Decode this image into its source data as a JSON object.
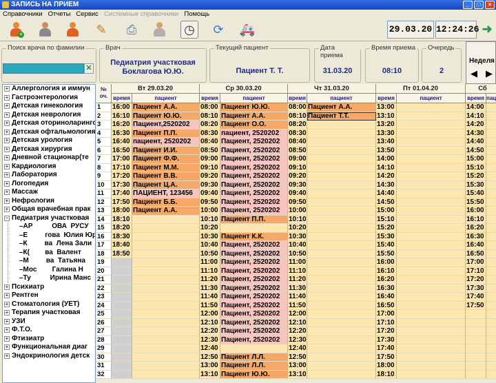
{
  "window": {
    "title": "ЗАПИСЬ НА ПРИЕМ"
  },
  "menu": [
    {
      "label": "Справочники",
      "disabled": false
    },
    {
      "label": "Отчеты",
      "disabled": false
    },
    {
      "label": "Сервис",
      "disabled": false
    },
    {
      "label": "Системные справочники",
      "disabled": true
    },
    {
      "label": "Помощь",
      "disabled": false
    }
  ],
  "toolbar": {
    "date": "29.03.20",
    "time": "12:24:26"
  },
  "panels": {
    "search": {
      "legend": "Поиск врача по фамилии",
      "value": ""
    },
    "doctor": {
      "legend": "Врач",
      "line1": "Педиатрия участковая",
      "line2": "Боклагова Ю.Ю."
    },
    "patient": {
      "legend": "Текущий пациент",
      "value": "Пациент Т. Т."
    },
    "visit_date": {
      "legend": "Дата приема",
      "value": "31.03.20"
    },
    "visit_time": {
      "legend": "Время приема",
      "value": "08:10"
    },
    "queue": {
      "legend": "Очередь",
      "value": "2"
    },
    "week": {
      "label": "Неделя"
    }
  },
  "tree": [
    {
      "label": "Аллергология и иммун",
      "expanded": false
    },
    {
      "label": "Гастроэнтерология",
      "expanded": false
    },
    {
      "label": "Детская гинекология",
      "expanded": false
    },
    {
      "label": "Детская неврология",
      "expanded": false
    },
    {
      "label": "Детская оториноларинголо",
      "expanded": false
    },
    {
      "label": "Детская офтальмология",
      "expanded": false
    },
    {
      "label": "Детская урология",
      "expanded": false
    },
    {
      "label": "Детская хирургия",
      "expanded": false
    },
    {
      "label": "Дневной стационар(те",
      "expanded": false
    },
    {
      "label": "Кардиология",
      "expanded": false
    },
    {
      "label": "Лаборатория",
      "expanded": false
    },
    {
      "label": "Логопедия",
      "expanded": false
    },
    {
      "label": "Массаж",
      "expanded": false
    },
    {
      "label": "Нефрология",
      "expanded": false
    },
    {
      "label": "Общая врачебная прак",
      "expanded": false
    },
    {
      "label": "Педиатрия участковая",
      "expanded": true,
      "children": [
        "АР          ОВА  РУСУ",
        "Е         гова  Юлия Юр",
        "К         ва  Лена Зали",
        "К(        ва  Валент",
        "М         ва  Татьяна",
        "Мос        Галина Н",
        "Ту          Ирина Манс"
      ]
    },
    {
      "label": "Психиатр",
      "expanded": false
    },
    {
      "label": "Рентген",
      "expanded": false
    },
    {
      "label": "Стоматология (УЕТ)",
      "expanded": false
    },
    {
      "label": "Терапия участковая",
      "expanded": false
    },
    {
      "label": "УЗИ",
      "expanded": false
    },
    {
      "label": "Ф.Т.О.",
      "expanded": false
    },
    {
      "label": "Фтизиатр",
      "expanded": false
    },
    {
      "label": "Функциональная диаг",
      "expanded": false
    },
    {
      "label": "Эндокринология детск",
      "expanded": false
    }
  ],
  "schedule": {
    "no_header": "№ оч.",
    "time_label": "время",
    "patient_label": "пациент",
    "days": [
      "Вт 29.03.20",
      "Ср 30.03.20",
      "Чт 31.03.20",
      "Пт 01.04.20",
      "Сб"
    ],
    "rows": [
      {
        "n": "1",
        "d": [
          [
            "16:00",
            "Пациент А.А.",
            "f"
          ],
          [
            "08:00",
            "Пациент Ю.Ю.",
            "f"
          ],
          [
            "08:00",
            "Пациент А.А.",
            "f"
          ],
          [
            "13:00",
            "",
            ""
          ],
          [
            "14:00",
            "",
            ""
          ]
        ]
      },
      {
        "n": "2",
        "d": [
          [
            "16:10",
            "Пациент Ю.Ю.",
            "f"
          ],
          [
            "08:10",
            "Пациент А.А.",
            "f"
          ],
          [
            "08:10",
            "Пациент Т.Т.",
            "f"
          ],
          [
            "13:10",
            "",
            ""
          ],
          [
            "14:10",
            "",
            ""
          ]
        ]
      },
      {
        "n": "3",
        "d": [
          [
            "16:20",
            "Пациент,2520202",
            "p"
          ],
          [
            "08:20",
            "Пациент О.О.",
            "f"
          ],
          [
            "08:20",
            "",
            ""
          ],
          [
            "13:20",
            "",
            ""
          ],
          [
            "14:20",
            "",
            ""
          ]
        ]
      },
      {
        "n": "4",
        "d": [
          [
            "16:30",
            "Пациент П.П.",
            "f"
          ],
          [
            "08:30",
            "пациент, 2520202",
            "p"
          ],
          [
            "08:30",
            "",
            ""
          ],
          [
            "13:30",
            "",
            ""
          ],
          [
            "14:30",
            "",
            ""
          ]
        ]
      },
      {
        "n": "5",
        "d": [
          [
            "16:40",
            "пациент, 2520202",
            "p"
          ],
          [
            "08:40",
            "Пациент, 2520202",
            "p"
          ],
          [
            "08:40",
            "",
            ""
          ],
          [
            "13:40",
            "",
            ""
          ],
          [
            "14:40",
            "",
            ""
          ]
        ]
      },
      {
        "n": "6",
        "d": [
          [
            "16:50",
            "Пациент И.И.",
            "f"
          ],
          [
            "08:50",
            "Пациент, 2520202",
            "p"
          ],
          [
            "08:50",
            "",
            ""
          ],
          [
            "13:50",
            "",
            ""
          ],
          [
            "14:50",
            "",
            ""
          ]
        ]
      },
      {
        "n": "7",
        "d": [
          [
            "17:00",
            "Пациент Ф.Ф.",
            "f"
          ],
          [
            "09:00",
            "Пациент, 2520202",
            "p"
          ],
          [
            "09:00",
            "",
            ""
          ],
          [
            "14:00",
            "",
            ""
          ],
          [
            "15:00",
            "",
            ""
          ]
        ]
      },
      {
        "n": "8",
        "d": [
          [
            "17:10",
            "Пациент М.М.",
            "f"
          ],
          [
            "09:10",
            "Пациент, 2520202",
            "p"
          ],
          [
            "09:10",
            "",
            ""
          ],
          [
            "14:10",
            "",
            ""
          ],
          [
            "15:10",
            "",
            ""
          ]
        ]
      },
      {
        "n": "9",
        "d": [
          [
            "17:20",
            "Пациент В.В.",
            "f"
          ],
          [
            "09:20",
            "Пациент, 2520202",
            "p"
          ],
          [
            "09:20",
            "",
            ""
          ],
          [
            "14:20",
            "",
            ""
          ],
          [
            "15:20",
            "",
            ""
          ]
        ]
      },
      {
        "n": "10",
        "d": [
          [
            "17:30",
            "Пациент Ц.А.",
            "f"
          ],
          [
            "09:30",
            "Пациент, 2520202",
            "p"
          ],
          [
            "09:30",
            "",
            ""
          ],
          [
            "14:30",
            "",
            ""
          ],
          [
            "15:30",
            "",
            ""
          ]
        ]
      },
      {
        "n": "11",
        "d": [
          [
            "17:40",
            "ПАЦИЕНТ, 123456",
            "p"
          ],
          [
            "09:40",
            "Пациент, 2520202",
            "p"
          ],
          [
            "09:40",
            "",
            ""
          ],
          [
            "14:40",
            "",
            ""
          ],
          [
            "15:40",
            "",
            ""
          ]
        ]
      },
      {
        "n": "12",
        "d": [
          [
            "17:50",
            "Пациент Б.Б.",
            "f"
          ],
          [
            "09:50",
            "Пациент, 2520202",
            "p"
          ],
          [
            "09:50",
            "",
            ""
          ],
          [
            "14:50",
            "",
            ""
          ],
          [
            "15:50",
            "",
            ""
          ]
        ]
      },
      {
        "n": "13",
        "d": [
          [
            "18:00",
            "Пациент А.А.",
            "f"
          ],
          [
            "10:00",
            "Пациент, 2520202",
            "p"
          ],
          [
            "10:00",
            "",
            ""
          ],
          [
            "15:00",
            "",
            ""
          ],
          [
            "16:00",
            "",
            ""
          ]
        ]
      },
      {
        "n": "14",
        "d": [
          [
            "18:10",
            "",
            ""
          ],
          [
            "10:10",
            "Пациент П.П.",
            "f"
          ],
          [
            "10:10",
            "",
            ""
          ],
          [
            "15:10",
            "",
            ""
          ],
          [
            "16:10",
            "",
            ""
          ]
        ]
      },
      {
        "n": "15",
        "d": [
          [
            "18:20",
            "",
            ""
          ],
          [
            "10:20",
            "",
            ""
          ],
          [
            "10:20",
            "",
            ""
          ],
          [
            "15:20",
            "",
            ""
          ],
          [
            "16:20",
            "",
            ""
          ]
        ]
      },
      {
        "n": "16",
        "d": [
          [
            "18:30",
            "",
            ""
          ],
          [
            "10:30",
            "Пациент К.К.",
            "f"
          ],
          [
            "10:30",
            "",
            ""
          ],
          [
            "15:30",
            "",
            ""
          ],
          [
            "16:30",
            "",
            ""
          ]
        ]
      },
      {
        "n": "17",
        "d": [
          [
            "18:40",
            "",
            ""
          ],
          [
            "10:40",
            "Пациент, 2520202",
            "p"
          ],
          [
            "10:40",
            "",
            ""
          ],
          [
            "15:40",
            "",
            ""
          ],
          [
            "16:40",
            "",
            ""
          ]
        ]
      },
      {
        "n": "18",
        "d": [
          [
            "18:50",
            "",
            ""
          ],
          [
            "10:50",
            "Пациент, 2520202",
            "p"
          ],
          [
            "10:50",
            "",
            ""
          ],
          [
            "15:50",
            "",
            ""
          ],
          [
            "16:50",
            "",
            ""
          ]
        ]
      },
      {
        "n": "19",
        "d": [
          [
            "",
            "",
            "e"
          ],
          [
            "11:00",
            "Пациент, 2520202",
            "p"
          ],
          [
            "11:00",
            "",
            ""
          ],
          [
            "16:00",
            "",
            ""
          ],
          [
            "17:00",
            "",
            ""
          ]
        ]
      },
      {
        "n": "20",
        "d": [
          [
            "",
            "",
            "e"
          ],
          [
            "11:10",
            "Пациент, 2520202",
            "p"
          ],
          [
            "11:10",
            "",
            ""
          ],
          [
            "16:10",
            "",
            ""
          ],
          [
            "17:10",
            "",
            ""
          ]
        ]
      },
      {
        "n": "21",
        "d": [
          [
            "",
            "",
            "e"
          ],
          [
            "11:20",
            "Пациент, 2520202",
            "p"
          ],
          [
            "11:20",
            "",
            ""
          ],
          [
            "16:20",
            "",
            ""
          ],
          [
            "17:20",
            "",
            ""
          ]
        ]
      },
      {
        "n": "22",
        "d": [
          [
            "",
            "",
            "e"
          ],
          [
            "11:30",
            "Пациент, 2520202",
            "p"
          ],
          [
            "11:30",
            "",
            ""
          ],
          [
            "16:30",
            "",
            ""
          ],
          [
            "17:30",
            "",
            ""
          ]
        ]
      },
      {
        "n": "23",
        "d": [
          [
            "",
            "",
            "e"
          ],
          [
            "11:40",
            "Пациент, 2520202",
            "p"
          ],
          [
            "11:40",
            "",
            ""
          ],
          [
            "16:40",
            "",
            ""
          ],
          [
            "17:40",
            "",
            ""
          ]
        ]
      },
      {
        "n": "24",
        "d": [
          [
            "",
            "",
            "e"
          ],
          [
            "11:50",
            "Пациент, 2520202",
            "p"
          ],
          [
            "11:50",
            "",
            ""
          ],
          [
            "16:50",
            "",
            ""
          ],
          [
            "17:50",
            "",
            ""
          ]
        ]
      },
      {
        "n": "25",
        "d": [
          [
            "",
            "",
            "e"
          ],
          [
            "12:00",
            "Пациент, 2520202",
            "p"
          ],
          [
            "12:00",
            "",
            ""
          ],
          [
            "17:00",
            "",
            ""
          ],
          [
            "",
            "",
            ""
          ]
        ]
      },
      {
        "n": "26",
        "d": [
          [
            "",
            "",
            "e"
          ],
          [
            "12:10",
            "Пациент, 2520202",
            "p"
          ],
          [
            "12:10",
            "",
            ""
          ],
          [
            "17:10",
            "",
            ""
          ],
          [
            "",
            "",
            ""
          ]
        ]
      },
      {
        "n": "27",
        "d": [
          [
            "",
            "",
            "e"
          ],
          [
            "12:20",
            "Пациент, 2520202",
            "p"
          ],
          [
            "12:20",
            "",
            ""
          ],
          [
            "17:20",
            "",
            ""
          ],
          [
            "",
            "",
            ""
          ]
        ]
      },
      {
        "n": "28",
        "d": [
          [
            "",
            "",
            "e"
          ],
          [
            "12:30",
            "Пациент, 2520202",
            "p"
          ],
          [
            "12:30",
            "",
            ""
          ],
          [
            "17:30",
            "",
            ""
          ],
          [
            "",
            "",
            ""
          ]
        ]
      },
      {
        "n": "29",
        "d": [
          [
            "",
            "",
            "e"
          ],
          [
            "12:40",
            "",
            ""
          ],
          [
            "12:40",
            "",
            ""
          ],
          [
            "17:40",
            "",
            ""
          ],
          [
            "",
            "",
            ""
          ]
        ]
      },
      {
        "n": "30",
        "d": [
          [
            "",
            "",
            "e"
          ],
          [
            "12:50",
            "Пациент Л.Л.",
            "f"
          ],
          [
            "12:50",
            "",
            ""
          ],
          [
            "17:50",
            "",
            ""
          ],
          [
            "",
            "",
            ""
          ]
        ]
      },
      {
        "n": "31",
        "d": [
          [
            "",
            "",
            "e"
          ],
          [
            "13:00",
            "Пациент Л.Л.",
            "f"
          ],
          [
            "13:00",
            "",
            ""
          ],
          [
            "18:00",
            "",
            ""
          ],
          [
            "",
            "",
            ""
          ]
        ]
      },
      {
        "n": "32",
        "d": [
          [
            "",
            "",
            "e"
          ],
          [
            "13:10",
            "Пациент Ю.Ю.",
            "f"
          ],
          [
            "13:10",
            "",
            ""
          ],
          [
            "18:10",
            "",
            ""
          ],
          [
            "",
            "",
            ""
          ]
        ]
      }
    ]
  }
}
